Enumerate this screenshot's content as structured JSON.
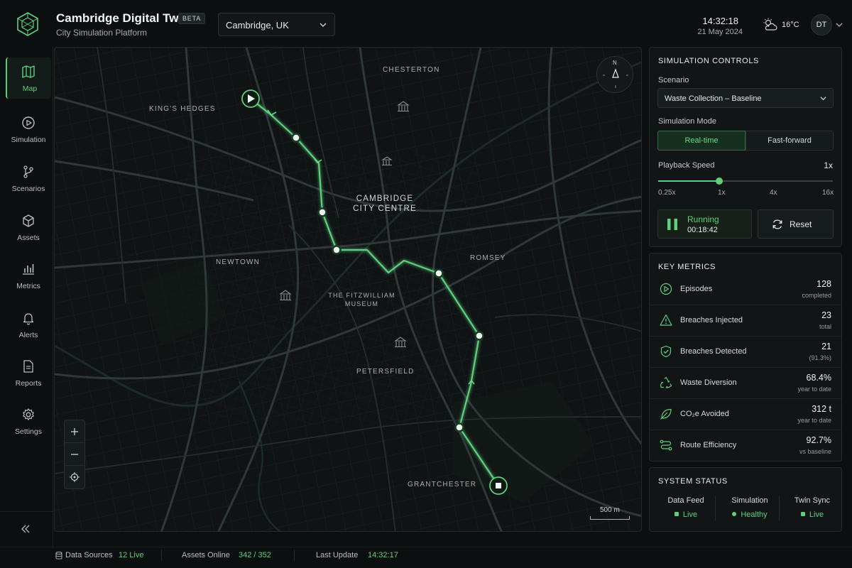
{
  "header": {
    "title": "Cambridge Digital Twin",
    "badge": "BETA",
    "subtitle": "City Simulation Platform",
    "city": "Cambridge, UK",
    "time": "14:32:18",
    "date": "21 May 2024",
    "temperature": "16°C",
    "user_initials": "DT"
  },
  "sidebar": {
    "items": [
      {
        "label": "Map",
        "icon": "map-icon",
        "active": true
      },
      {
        "label": "Simulation",
        "icon": "play-circle-icon"
      },
      {
        "label": "Scenarios",
        "icon": "branch-icon"
      },
      {
        "label": "Assets",
        "icon": "cube-icon"
      },
      {
        "label": "Metrics",
        "icon": "bar-chart-icon"
      },
      {
        "label": "Alerts",
        "icon": "bell-icon"
      },
      {
        "label": "Reports",
        "icon": "document-icon"
      },
      {
        "label": "Settings",
        "icon": "gear-icon"
      }
    ]
  },
  "map": {
    "labels": {
      "chesterton": "CHESTERTON",
      "kings_hedges": "KING'S HEDGES",
      "city_centre_1": "CAMBRIDGE",
      "city_centre_2": "CITY CENTRE",
      "newtown": "NEWTOWN",
      "romsey": "ROMSEY",
      "fitz_1": "THE FITZWILLIAM",
      "fitz_2": "MUSEUM",
      "petersfield": "PETERSFIELD",
      "grantchester": "GRANTCHESTER"
    },
    "compass_north": "N",
    "scale": "500 m"
  },
  "controls": {
    "title": "SIMULATION CONTROLS",
    "scenario_label": "Scenario",
    "scenario_value": "Waste Collection – Baseline",
    "mode_label": "Simulation Mode",
    "mode_options": [
      "Real-time",
      "Fast-forward"
    ],
    "mode_selected": "Real-time",
    "speed_label": "Playback Speed",
    "speed_value": "1x",
    "speed_level": 0.35,
    "speed_ticks": [
      "0.25x",
      "1x",
      "4x",
      "16x"
    ],
    "run_status": "Running",
    "run_time": "00:18:42",
    "reset_label": "Reset"
  },
  "metrics": {
    "title": "KEY METRICS",
    "items": [
      {
        "name": "Episodes",
        "value": "128",
        "sub": "completed",
        "icon": "play-circle-icon"
      },
      {
        "name": "Breaches Injected",
        "value": "23",
        "sub": "total",
        "icon": "warning-icon"
      },
      {
        "name": "Breaches Detected",
        "value": "21",
        "sub": "(91.3%)",
        "icon": "shield-check-icon"
      },
      {
        "name": "Waste Diversion",
        "value": "68.4%",
        "sub": "year to date",
        "icon": "recycle-icon"
      },
      {
        "name": "CO₂e Avoided",
        "value": "312 t",
        "sub": "year to date",
        "icon": "leaf-icon"
      },
      {
        "name": "Route Efficiency",
        "value": "92.7%",
        "sub": "vs baseline",
        "icon": "route-icon"
      }
    ]
  },
  "system_status": {
    "title": "SYSTEM STATUS",
    "items": [
      {
        "name": "Data Feed",
        "value": "Live"
      },
      {
        "name": "Simulation",
        "value": "Healthy"
      },
      {
        "name": "Twin Sync",
        "value": "Live"
      }
    ]
  },
  "footer": {
    "data_sources_label": "Data Sources",
    "data_sources_value": "12 Live",
    "assets_label": "Assets Online",
    "assets_value": "342 / 352",
    "update_label": "Last Update",
    "update_value": "14:32:17"
  },
  "colors": {
    "accent": "#5fcf7d",
    "background": "#0c0f10",
    "panel": "#111516"
  }
}
